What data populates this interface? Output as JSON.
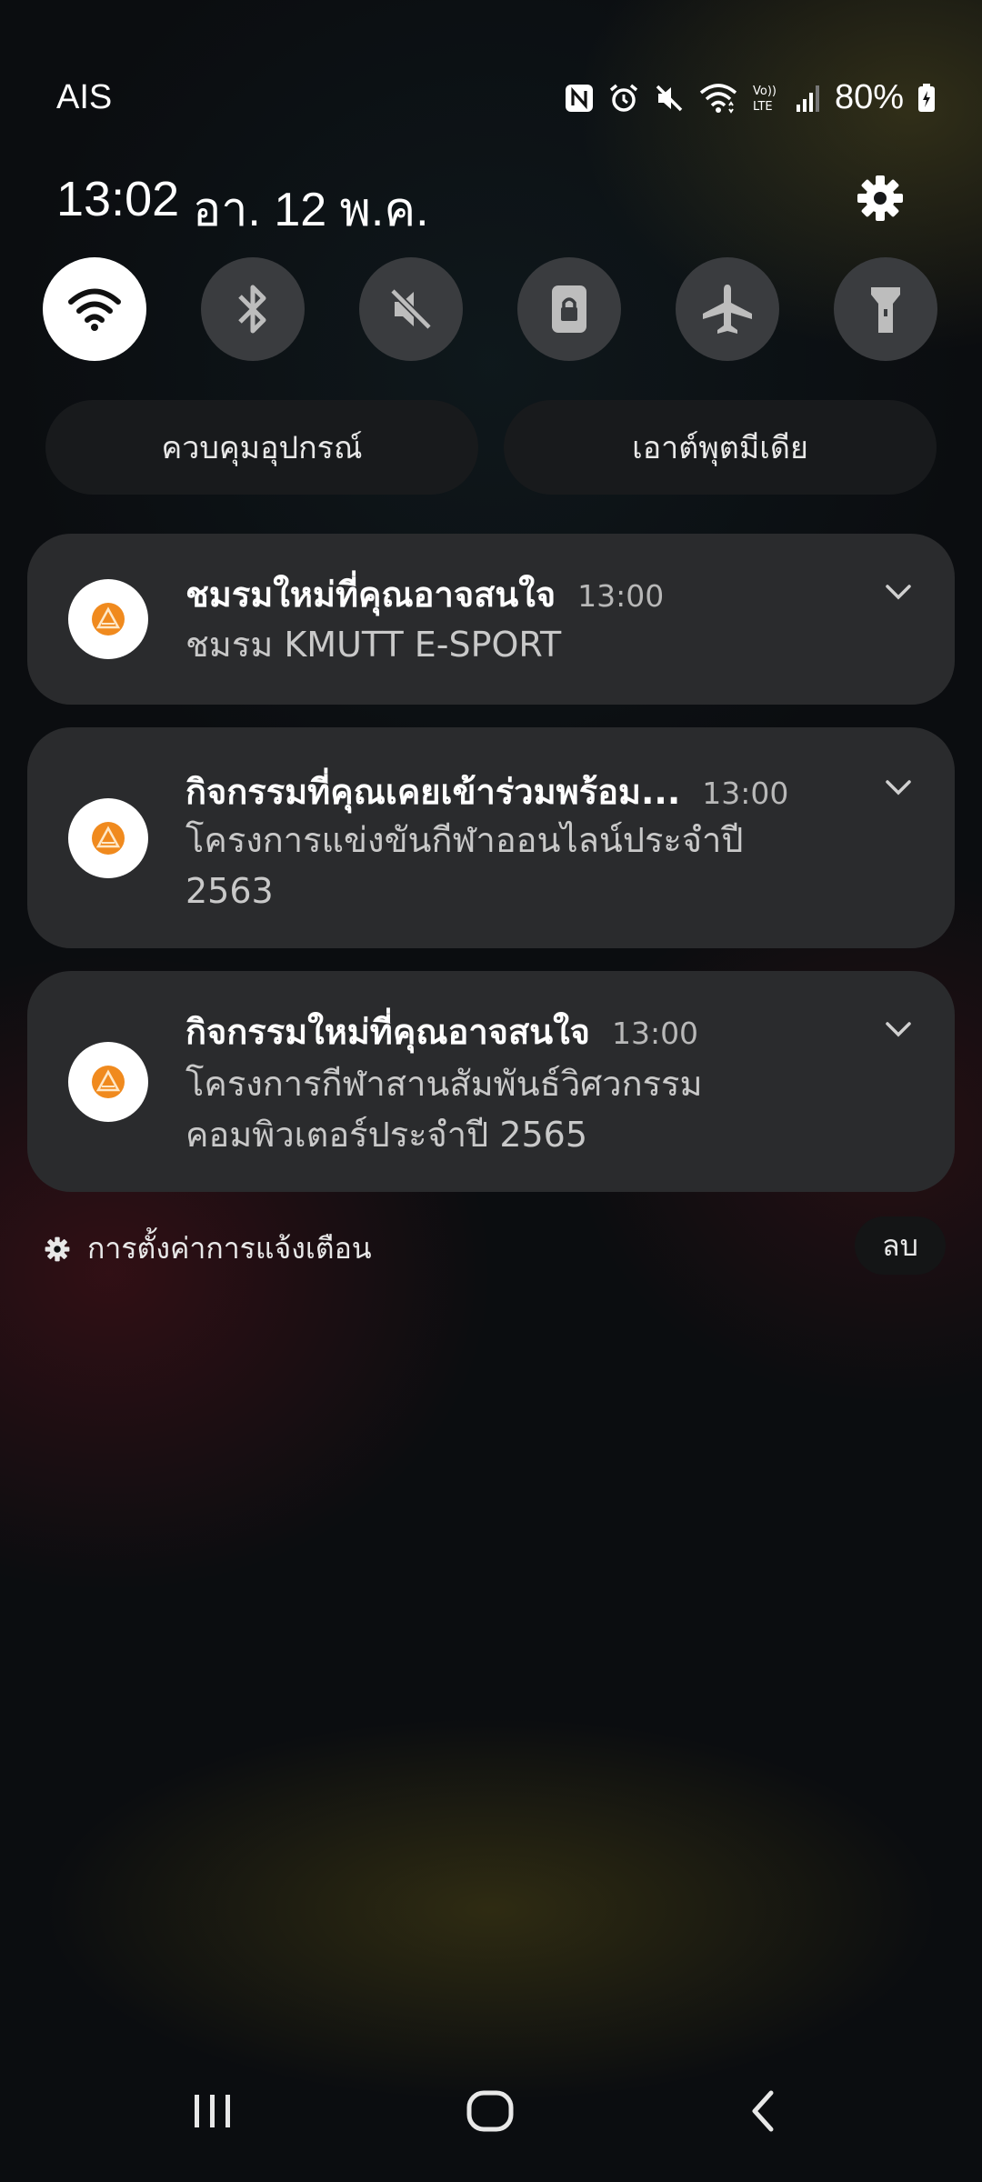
{
  "status_bar": {
    "carrier": "AIS",
    "battery": "80%",
    "icons": [
      "nfc-icon",
      "alarm-icon",
      "mute-icon",
      "wifi-icon",
      "volte-icon",
      "signal-icon",
      "battery-icon"
    ],
    "volte_label_top": "Vo))",
    "volte_label_bottom": "LTE"
  },
  "header": {
    "time": "13:02",
    "date": "อา. 12 พ.ค."
  },
  "quick_toggles": [
    {
      "name": "wifi",
      "on": true
    },
    {
      "name": "bluetooth",
      "on": false
    },
    {
      "name": "sound",
      "on": false
    },
    {
      "name": "screen-lock",
      "on": false
    },
    {
      "name": "airplane",
      "on": false
    },
    {
      "name": "flashlight",
      "on": false
    }
  ],
  "pills": {
    "device_control": "ควบคุมอุปกรณ์",
    "media_output": "เอาต์พุตมีเดีย"
  },
  "notifications": [
    {
      "title": "ชมรมใหม่ที่คุณอาจสนใจ",
      "time": "13:00",
      "body": "ชมรม KMUTT E-SPORT"
    },
    {
      "title": "กิจกรรมที่คุณเคยเข้าร่วมพร้อม...",
      "time": "13:00",
      "body": "โครงการแข่งขันกีฬาออนไลน์ประจำปี 2563"
    },
    {
      "title": "กิจกรรมใหม่ที่คุณอาจสนใจ",
      "time": "13:00",
      "body": "โครงการกีฬาสานสัมพันธ์วิศวกรรม คอมพิวเตอร์ประจำปี 2565"
    }
  ],
  "footer": {
    "notification_settings": "การตั้งค่าการแจ้งเตือน",
    "clear": "ลบ"
  },
  "colors": {
    "toggle_on": "#ffffff",
    "toggle_off": "#3a3c3f",
    "card": "#2a2b2d",
    "app_accent": "#f08a1e"
  }
}
